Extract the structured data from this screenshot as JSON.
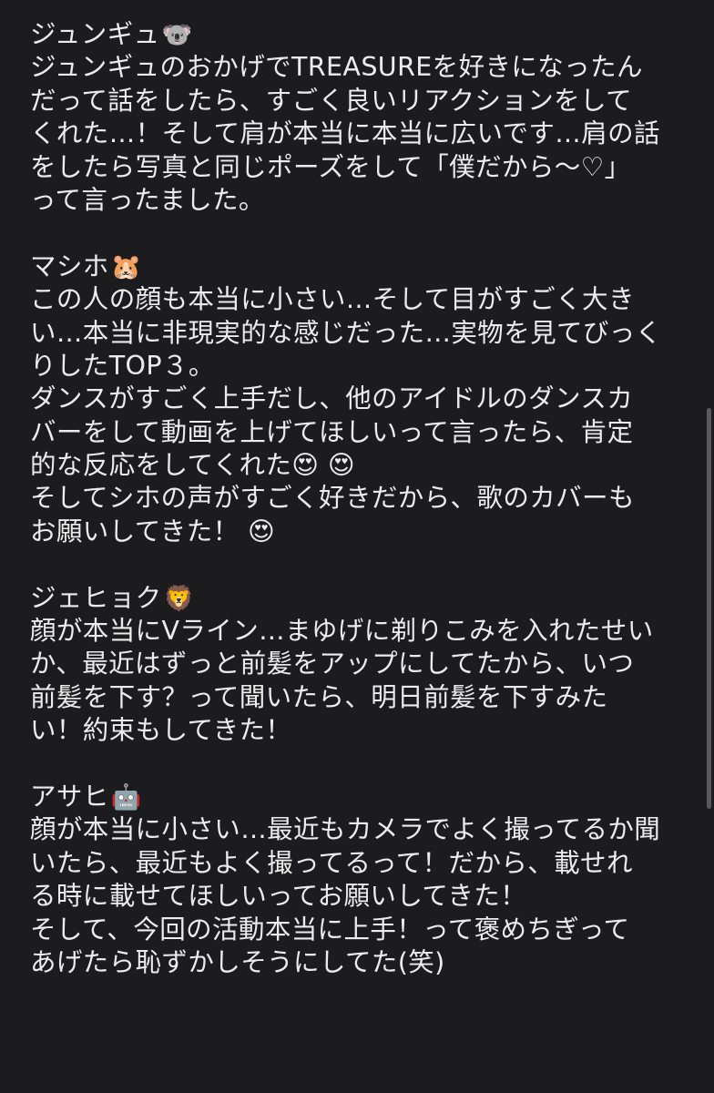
{
  "sections": [
    {
      "name": "ジュンギュ",
      "emoji": "🐨",
      "lines": [
        "ジュンギュのおかげでTREASUREを好きになったん",
        "だって話をしたら、すごく良いリアクションをして",
        "くれた…！そして肩が本当に本当に広いです…肩の話",
        "をしたら写真と同じポーズをして「僕だから〜♡」",
        "って言ったました。"
      ]
    },
    {
      "name": "マシホ",
      "emoji": "🐹",
      "lines": [
        "この人の顔も本当に小さい…そして目がすごく大き",
        "い…本当に非現実的な感じだった…実物を見てびっく",
        "りしたTOP３。",
        "ダンスがすごく上手だし、他のアイドルのダンスカ",
        "バーをして動画を上げてほしいって言ったら、肯定",
        "的な反応をしてくれた😍 😍",
        "そしてシホの声がすごく好きだから、歌のカバーも",
        "お願いしてきた！ 😍"
      ]
    },
    {
      "name": "ジェヒョク",
      "emoji": "🦁",
      "lines": [
        "顔が本当にVライン…まゆげに剃りこみを入れたせい",
        "か、最近はずっと前髪をアップにしてたから、いつ",
        "前髪を下す？って聞いたら、明日前髪を下すみた",
        "い！約束もしてきた！"
      ]
    },
    {
      "name": "アサヒ",
      "emoji": "🤖",
      "lines": [
        "顔が本当に小さい…最近もカメラでよく撮ってるか聞",
        "いたら、最近もよく撮ってるって！だから、載せれ",
        "る時に載せてほしいってお願いしてきた！",
        "そして、今回の活動本当に上手！って褒めちぎって",
        "あげたら恥ずかしそうにしてた(笑)"
      ]
    }
  ]
}
